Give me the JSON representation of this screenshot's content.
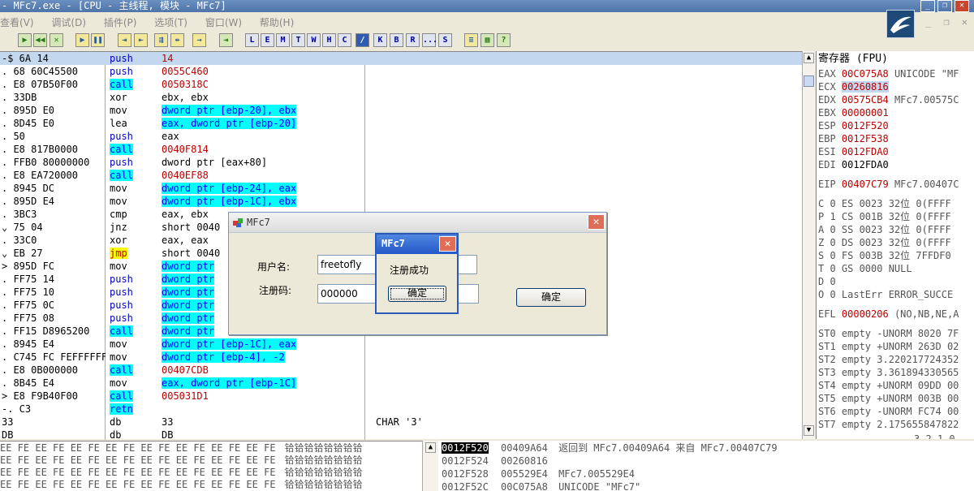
{
  "window": {
    "title": "- MFc7.exe - [CPU - 主线程, 模块 - MFc7]"
  },
  "menu": [
    "查看(V)",
    "调试(D)",
    "插件(P)",
    "选项(T)",
    "窗口(W)",
    "帮助(H)"
  ],
  "toolbar": {
    "left_buttons": [
      "▶",
      "◀◀",
      "✕",
      "▶",
      "❚❚",
      "⇥",
      "⇤",
      "⇶",
      "⇷",
      "→",
      "⇥"
    ],
    "letters": [
      "L",
      "E",
      "M",
      "T",
      "W",
      "H",
      "C",
      "/",
      "K",
      "B",
      "R",
      "...",
      "S"
    ],
    "right_buttons": [
      "≡",
      "▦",
      "?"
    ]
  },
  "disasm": [
    {
      "addr": "-$  6A 14",
      "mn": "push",
      "op": "14",
      "cm": ""
    },
    {
      "addr": ".  68 60C45500",
      "mn": "push",
      "op": "0055C460",
      "cm": ""
    },
    {
      "addr": ".  E8 07B50F00",
      "mn": "call",
      "op": "0050318C",
      "cm": ""
    },
    {
      "addr": ".  33DB",
      "mn": "xor",
      "op": "ebx, ebx",
      "cm": ""
    },
    {
      "addr": ".  895D E0",
      "mn": "mov",
      "op": "dword ptr [ebp-20], ebx",
      "cm": ""
    },
    {
      "addr": ".  8D45 E0",
      "mn": "lea",
      "op": "eax, dword ptr [ebp-20]",
      "cm": ""
    },
    {
      "addr": ".  50",
      "mn": "push",
      "op": "eax",
      "cm": ""
    },
    {
      "addr": ".  E8 817B0000",
      "mn": "call",
      "op": "0040F814",
      "cm": ""
    },
    {
      "addr": ".  FFB0 80000000",
      "mn": "push",
      "op": "dword ptr [eax+80]",
      "cm": ""
    },
    {
      "addr": ".  E8 EA720000",
      "mn": "call",
      "op": "0040EF88",
      "cm": ""
    },
    {
      "addr": ".  8945 DC",
      "mn": "mov",
      "op": "dword ptr [ebp-24], eax",
      "cm": ""
    },
    {
      "addr": ".  895D E4",
      "mn": "mov",
      "op": "dword ptr [ebp-1C], ebx",
      "cm": ""
    },
    {
      "addr": ".  3BC3",
      "mn": "cmp",
      "op": "eax, ebx",
      "cm": ""
    },
    {
      "addr": "⌄  75 04",
      "mn": "jnz",
      "op": "short 0040",
      "cm": ""
    },
    {
      "addr": ".  33C0",
      "mn": "xor",
      "op": "eax, eax",
      "cm": ""
    },
    {
      "addr": "⌄  EB 27",
      "mn": "jmp",
      "op": "short 0040",
      "cm": ""
    },
    {
      "addr": ">  895D FC",
      "mn": "mov",
      "op": "dword ptr",
      "cm": ""
    },
    {
      "addr": ".  FF75 14",
      "mn": "push",
      "op": "dword ptr",
      "cm": ""
    },
    {
      "addr": ".  FF75 10",
      "mn": "push",
      "op": "dword ptr",
      "cm": ""
    },
    {
      "addr": ".  FF75 0C",
      "mn": "push",
      "op": "dword ptr",
      "cm": ""
    },
    {
      "addr": ".  FF75 08",
      "mn": "push",
      "op": "dword ptr",
      "cm": ""
    },
    {
      "addr": ".  FF15 D8965200",
      "mn": "call",
      "op": "dword ptr",
      "cm": ""
    },
    {
      "addr": ".  8945 E4",
      "mn": "mov",
      "op": "dword ptr [ebp-1C], eax",
      "cm": ""
    },
    {
      "addr": ".  C745 FC FEFFFFFF",
      "mn": "mov",
      "op": "dword ptr [ebp-4], -2",
      "cm": ""
    },
    {
      "addr": ".  E8 0B000000",
      "mn": "call",
      "op": "00407CDB",
      "cm": ""
    },
    {
      "addr": ".  8B45 E4",
      "mn": "mov",
      "op": "eax, dword ptr [ebp-1C]",
      "cm": ""
    },
    {
      "addr": ">  E8 F9B40F00",
      "mn": "call",
      "op": "005031D1",
      "cm": ""
    },
    {
      "addr": "-. C3",
      "mn": "retn",
      "op": "",
      "cm": ""
    },
    {
      "addr": "   33",
      "mn": "db",
      "op": "33",
      "cm": "CHAR '3'"
    },
    {
      "addr": "   DB",
      "mn": "db",
      "op": "DB",
      "cm": ""
    }
  ],
  "registers": {
    "header": "寄存器 (FPU)",
    "gp": [
      {
        "name": "EAX",
        "val": "00C075A8",
        "note": "UNICODE \"MF"
      },
      {
        "name": "ECX",
        "val": "00260816",
        "note": ""
      },
      {
        "name": "EDX",
        "val": "00575CB4",
        "note": "MFc7.00575C"
      },
      {
        "name": "EBX",
        "val": "00000001",
        "note": ""
      },
      {
        "name": "ESP",
        "val": "0012F520",
        "note": ""
      },
      {
        "name": "EBP",
        "val": "0012F538",
        "note": ""
      },
      {
        "name": "ESI",
        "val": "0012FDA0",
        "note": ""
      },
      {
        "name": "EDI",
        "val": "0012FDA0",
        "note": ""
      }
    ],
    "eip": {
      "name": "EIP",
      "val": "00407C79",
      "note": "MFc7.00407C"
    },
    "flags": [
      "C 0  ES 0023 32位 0(FFFF",
      "P 1  CS 001B 32位 0(FFFF",
      "A 0  SS 0023 32位 0(FFFF",
      "Z 0  DS 0023 32位 0(FFFF",
      "S 0  FS 003B 32位 7FFDF0",
      "T 0  GS 0000 NULL",
      "D 0",
      "O 0  LastErr ERROR_SUCCE"
    ],
    "efl": {
      "name": "EFL",
      "val": "00000206",
      "note": "(NO,NB,NE,A"
    },
    "fpu": [
      "ST0 empty -UNORM 8020 7F",
      "ST1 empty +UNORM 263D 02",
      "ST2 empty 3.220217724352",
      "ST3 empty 3.361894330565",
      "ST4 empty +UNORM 09DD 00",
      "ST5 empty +UNORM 003B 00",
      "ST6 empty -UNORM FC74 00",
      "ST7 empty 2.175655847822"
    ],
    "footer": "3 2 1 0"
  },
  "dump": {
    "hex_row": "EE FE EE FE  EE FE EE FE  EE FE EE FE  EE FE EE FE",
    "ascii_row": "铪铪铪铪铪铪铪铪"
  },
  "stack": [
    {
      "addr": "0012F520",
      "val": "00409A64",
      "note": "返回到 MFc7.00409A64 来自 MFc7.00407C79"
    },
    {
      "addr": "0012F524",
      "val": "00260816",
      "note": ""
    },
    {
      "addr": "0012F528",
      "val": "005529E4",
      "note": "MFc7.005529E4"
    },
    {
      "addr": "0012F52C",
      "val": "00C075A8",
      "note": "UNICODE \"MFc7\""
    }
  ],
  "dialog_main": {
    "title": "MFc7",
    "username_label": "用户名:",
    "username_value": "freetofly",
    "code_label": "注册码:",
    "code_value": "000000",
    "ok_label": "确定"
  },
  "dialog_msg": {
    "title": "MFc7",
    "message": "注册成功",
    "ok_label": "确定"
  }
}
